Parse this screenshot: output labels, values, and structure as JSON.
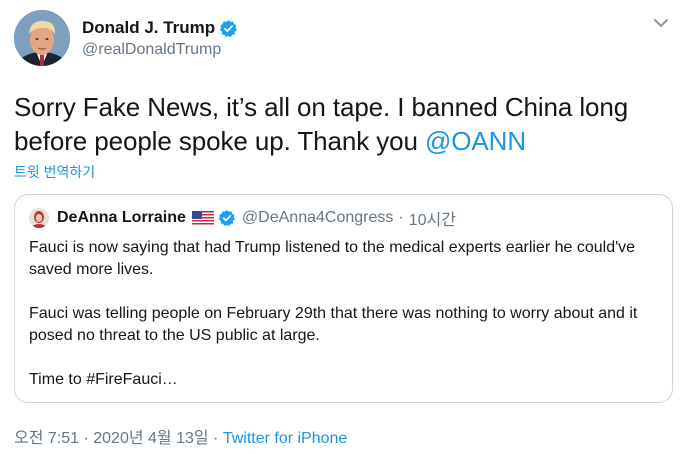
{
  "tweet": {
    "author": {
      "display_name": "Donald J. Trump",
      "handle": "@realDonaldTrump",
      "verified_icon": "verified-badge-icon"
    },
    "text_before_mention": "Sorry Fake News, it’s all on tape. I banned China long before people spoke up. Thank you ",
    "mention": "@OANN",
    "translate_label": "트윗 번역하기",
    "timestamp": "오전 7:51 · 2020년 4월 13일 · ",
    "source": "Twitter for iPhone",
    "menu_icon": "chevron-down-icon"
  },
  "quoted": {
    "display_name": "DeAnna Lorraine",
    "flag_icon": "us-flag-icon",
    "handle": "@DeAnna4Congress",
    "separator": "·",
    "time": "10시간",
    "paragraphs": [
      "Fauci is now saying that had Trump listened to the medical experts earlier he could've saved more lives.",
      "Fauci was telling people on February 29th that there was nothing to worry about and it posed no threat to the US public at large.",
      "Time to #FireFauci…"
    ]
  },
  "colors": {
    "accent": "#1b95e0",
    "secondary_text": "#657786",
    "border": "#ccd6dd",
    "primary_text": "#14171a"
  }
}
